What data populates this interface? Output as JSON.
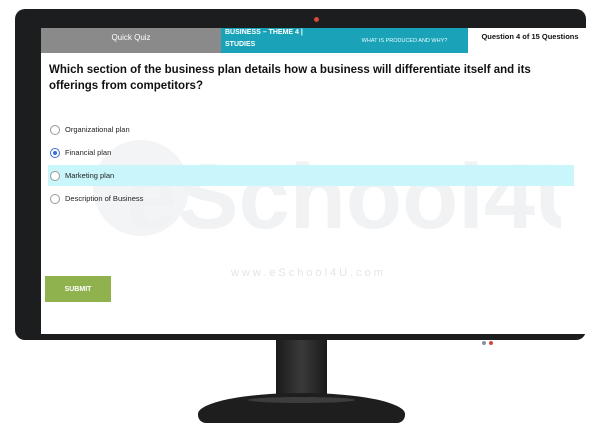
{
  "header": {
    "quiz_title": "Quick Quiz",
    "subject_line1": "BUSINESS      – THEME  4  |",
    "subject_line2": "STUDIES",
    "topic": "WHAT IS PRODUCED AND WHY?",
    "progress": "Question 4 of 15 Questions"
  },
  "question": {
    "text": "Which section of the business plan details how a business will differentiate itself and its offerings from competitors?"
  },
  "options": [
    {
      "label": "Organizational plan",
      "selected": false,
      "highlighted": false
    },
    {
      "label": "Financial plan",
      "selected": true,
      "highlighted": false
    },
    {
      "label": "Marketing plan",
      "selected": false,
      "highlighted": true
    },
    {
      "label": "Description of Business",
      "selected": false,
      "highlighted": false
    }
  ],
  "submit_label": "SUBMIT",
  "watermark": {
    "brand": "eSchool4U",
    "url": "www.eSchool4U.com"
  },
  "colors": {
    "header_gray": "#8a8a8a",
    "header_teal": "#1aa3b8",
    "highlight": "#c8f6fb",
    "submit_green": "#8fb24f",
    "radio_selected": "#3a6fd6",
    "webcam_red": "#d24a3a"
  }
}
